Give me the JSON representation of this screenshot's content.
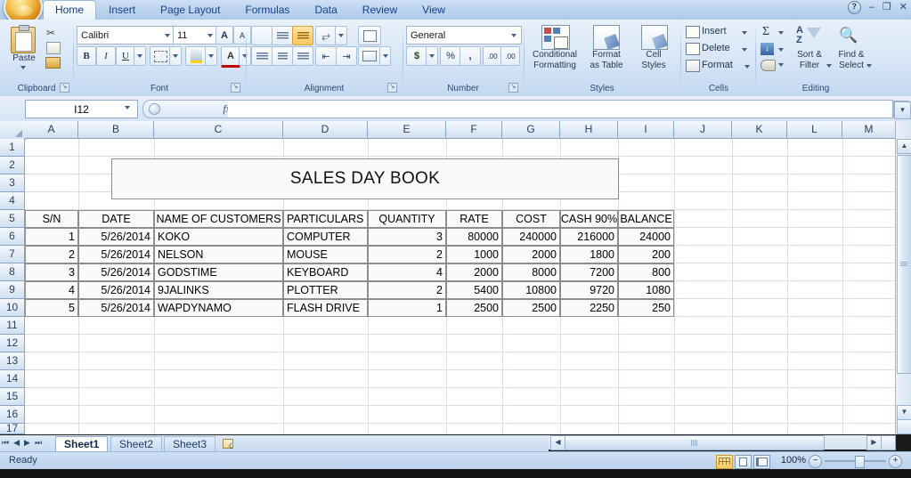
{
  "window": {
    "active_tab": "Home",
    "tabs": [
      "Home",
      "Insert",
      "Page Layout",
      "Formulas",
      "Data",
      "Review",
      "View"
    ],
    "help_icon": "help-icon",
    "minimize": "–",
    "restore": "❐",
    "close": "✕"
  },
  "ribbon": {
    "groups": [
      {
        "label": "Clipboard"
      },
      {
        "label": "Font"
      },
      {
        "label": "Alignment"
      },
      {
        "label": "Number"
      },
      {
        "label": "Styles"
      },
      {
        "label": "Cells"
      },
      {
        "label": "Editing"
      }
    ],
    "clipboard": {
      "paste_label": "Paste",
      "cut_icon": "scissors-icon",
      "copy_icon": "copy-icon",
      "format_painter_icon": "paintbrush-icon",
      "dialog_launcher": "↘"
    },
    "font": {
      "family": "Calibri",
      "size": "11",
      "grow_font": "A",
      "shrink_font": "A",
      "bold": "B",
      "italic": "I",
      "underline": "U",
      "borders_icon": "borders-icon",
      "fill_color_icon": "fill-color-icon",
      "font_color": "A",
      "dialog_launcher": "↘"
    },
    "alignment": {
      "top_align_icon": "align-top-icon",
      "middle_align_icon": "align-middle-icon",
      "bottom_align_icon": "align-bottom-icon",
      "orientation_icon": "orientation-icon",
      "align_left_icon": "align-left-icon",
      "align_center_icon": "align-center-icon",
      "align_right_icon": "align-right-icon",
      "decrease_indent_icon": "decrease-indent-icon",
      "increase_indent_icon": "increase-indent-icon",
      "wrap_text_icon": "wrap-text-icon",
      "merge_center_icon": "merge-center-icon",
      "dialog_launcher": "↘"
    },
    "number": {
      "format": "General",
      "accounting": "$",
      "percent": "%",
      "comma": ",",
      "increase_decimal": ".00",
      "decrease_decimal": ".00",
      "dialog_launcher": "↘"
    },
    "styles": {
      "conditional_formatting": "Conditional\nFormatting",
      "conditional_formatting_l1": "Conditional",
      "conditional_formatting_l2": "Formatting",
      "format_as_table_l1": "Format",
      "format_as_table_l2": "as Table",
      "cell_styles_l1": "Cell",
      "cell_styles_l2": "Styles"
    },
    "cells": {
      "insert": "Insert",
      "delete": "Delete",
      "format": "Format"
    },
    "editing": {
      "autosum": "Σ",
      "fill_icon": "fill-down-icon",
      "clear_icon": "eraser-icon",
      "sort_filter_l1": "Sort &",
      "sort_filter_l2": "Filter",
      "find_select_l1": "Find &",
      "find_select_l2": "Select"
    }
  },
  "formula_bar": {
    "name_box": "I12",
    "fx_label": "fx",
    "formula_value": "",
    "expand_icon": "⌄"
  },
  "grid": {
    "columns": [
      "A",
      "B",
      "C",
      "D",
      "E",
      "F",
      "G",
      "H",
      "I",
      "J",
      "K",
      "L",
      "M"
    ],
    "rows": [
      "1",
      "2",
      "3",
      "4",
      "5",
      "6",
      "7",
      "8",
      "9",
      "10",
      "11",
      "12",
      "13",
      "14",
      "15",
      "16",
      "17"
    ],
    "title_cell": "SALES DAY BOOK",
    "headers": [
      "S/N",
      "DATE",
      "NAME OF CUSTOMERS",
      "PARTICULARS",
      "QUANTITY",
      "RATE",
      "COST",
      "CASH 90%",
      "BALANCE"
    ],
    "records": [
      {
        "sn": "1",
        "date": "5/26/2014",
        "customer": "KOKO",
        "particulars": "COMPUTER",
        "quantity": "3",
        "rate": "80000",
        "cost": "240000",
        "cash90": "216000",
        "balance": "24000"
      },
      {
        "sn": "2",
        "date": "5/26/2014",
        "customer": "NELSON",
        "particulars": "MOUSE",
        "quantity": "2",
        "rate": "1000",
        "cost": "2000",
        "cash90": "1800",
        "balance": "200"
      },
      {
        "sn": "3",
        "date": "5/26/2014",
        "customer": "GODSTIME",
        "particulars": "KEYBOARD",
        "quantity": "4",
        "rate": "2000",
        "cost": "8000",
        "cash90": "7200",
        "balance": "800"
      },
      {
        "sn": "4",
        "date": "5/26/2014",
        "customer": "9JALINKS",
        "particulars": "PLOTTER",
        "quantity": "2",
        "rate": "5400",
        "cost": "10800",
        "cash90": "9720",
        "balance": "1080"
      },
      {
        "sn": "5",
        "date": "5/26/2014",
        "customer": "WAPDYNAMO",
        "particulars": "FLASH DRIVE",
        "quantity": "1",
        "rate": "2500",
        "cost": "2500",
        "cash90": "2250",
        "balance": "250"
      }
    ]
  },
  "sheet_tabs": {
    "items": [
      "Sheet1",
      "Sheet2",
      "Sheet3"
    ],
    "active": "Sheet1",
    "insert_sheet_icon": "insert-sheet-icon",
    "first_icon": "⏮",
    "prev_icon": "◀",
    "next_icon": "▶",
    "last_icon": "⏭"
  },
  "status_bar": {
    "state": "Ready",
    "zoom": "100%",
    "zoom_out": "−",
    "zoom_in": "+",
    "view_normal": "normal-view-icon",
    "view_page_layout": "page-layout-view-icon",
    "view_page_break": "page-break-view-icon"
  }
}
